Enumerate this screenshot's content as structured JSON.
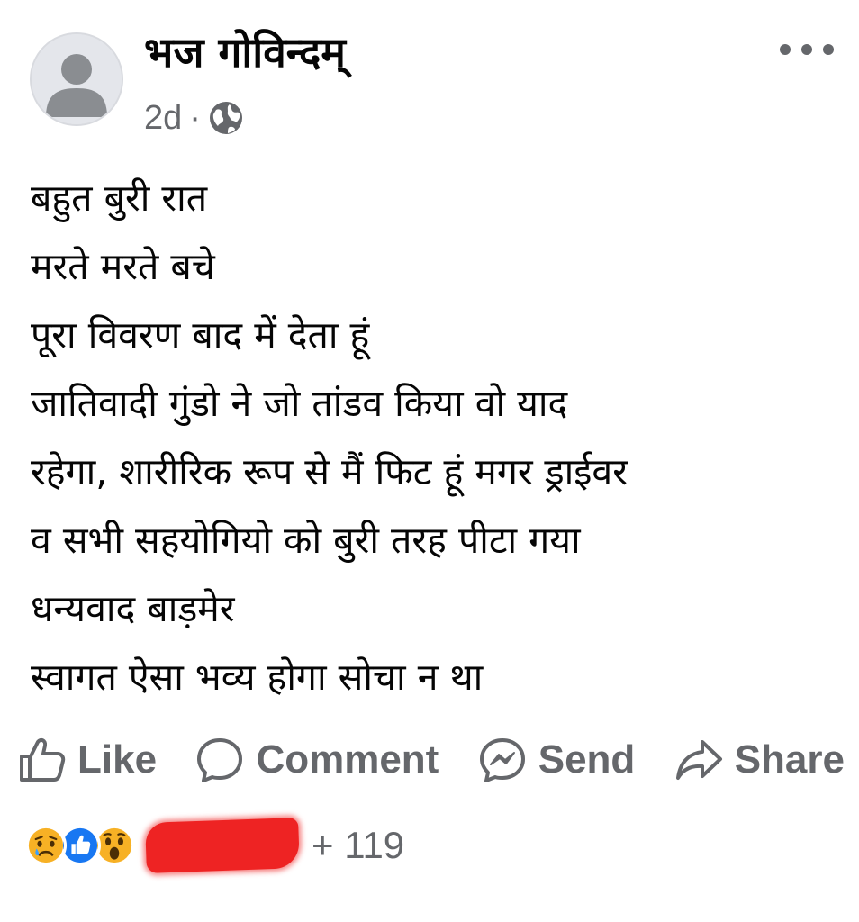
{
  "post": {
    "author": "भज गोविन्दम्",
    "time": "2d",
    "separator": "·",
    "privacy_icon": "globe-icon",
    "menu_icon": "more-options-icon",
    "lines": [
      "बहुत बुरी रात",
      "मरते मरते बचे",
      "पूरा विवरण बाद में देता हूं",
      "जातिवादी गुंडो ने जो तांडव किया  वो याद",
      "रहेगा, शारीरिक रूप से मैं फिट हूं मगर ड्राईवर",
      "व सभी सहयोगियो को बुरी तरह पीटा गया",
      "धन्यवाद बाड़मेर",
      "स्वागत ऐसा भव्य होगा सोचा न था"
    ]
  },
  "actions": {
    "like": "Like",
    "comment": "Comment",
    "send": "Send",
    "share": "Share"
  },
  "reactions": {
    "icons": [
      "sad-face-icon",
      "like-reaction-icon",
      "wow-face-icon"
    ],
    "count": "+ 119"
  },
  "colors": {
    "text": "#050505",
    "secondary": "#65676b",
    "like_blue": "#1877f2",
    "reaction_yellow": "#f7b125",
    "redaction": "#ee2323"
  }
}
